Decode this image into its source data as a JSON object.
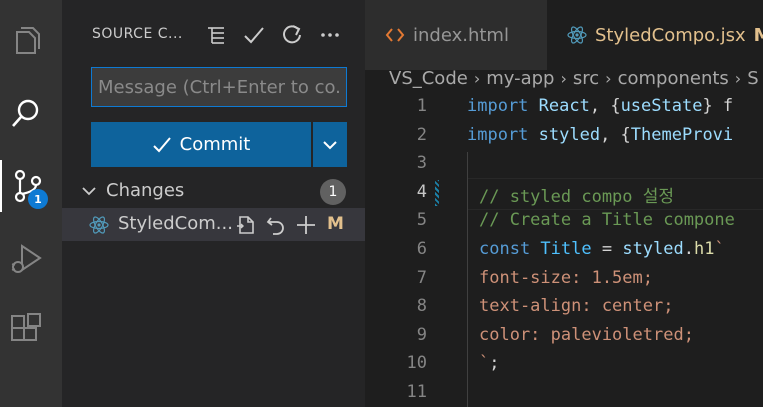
{
  "activity_bar": {
    "items": [
      {
        "name": "explorer",
        "icon": "files-icon"
      },
      {
        "name": "search",
        "icon": "search-icon"
      },
      {
        "name": "source-control",
        "icon": "source-control-icon",
        "badge": "1"
      },
      {
        "name": "run-debug",
        "icon": "run-debug-icon"
      },
      {
        "name": "extensions",
        "icon": "extensions-icon"
      }
    ]
  },
  "sidebar": {
    "title": "SOURCE C...",
    "message_placeholder": "Message (Ctrl+Enter to co...",
    "commit_label": "Commit",
    "changes": {
      "label": "Changes",
      "count": "1",
      "files": [
        {
          "name": "StyledCom...",
          "status": "M"
        }
      ]
    }
  },
  "editor": {
    "tabs": [
      {
        "label": "index.html",
        "active": false
      },
      {
        "label": "StyledCompo.jsx",
        "active": true,
        "modified": "M"
      }
    ],
    "breadcrumb": [
      "VS_Code",
      "my-app",
      "src",
      "components",
      "S"
    ],
    "lines": [
      {
        "n": "1",
        "tokens": [
          {
            "t": "import ",
            "c": "#569cd6"
          },
          {
            "t": "React",
            "c": "#9cdcfe"
          },
          {
            "t": ", {",
            "c": "#d4d4d4"
          },
          {
            "t": "useState",
            "c": "#9cdcfe"
          },
          {
            "t": "} f",
            "c": "#d4d4d4"
          }
        ]
      },
      {
        "n": "2",
        "tokens": [
          {
            "t": "import ",
            "c": "#569cd6"
          },
          {
            "t": "styled",
            "c": "#9cdcfe"
          },
          {
            "t": ", {",
            "c": "#d4d4d4"
          },
          {
            "t": "ThemeProvi",
            "c": "#9cdcfe"
          }
        ]
      },
      {
        "n": "3",
        "tokens": []
      },
      {
        "n": "4",
        "tokens": [
          {
            "t": "// styled compo 설정",
            "c": "#6a9955"
          }
        ]
      },
      {
        "n": "5",
        "tokens": [
          {
            "t": "// Create a Title compone",
            "c": "#6a9955"
          }
        ]
      },
      {
        "n": "6",
        "tokens": [
          {
            "t": "const ",
            "c": "#569cd6"
          },
          {
            "t": "Title",
            "c": "#4fc1ff"
          },
          {
            "t": " = ",
            "c": "#d4d4d4"
          },
          {
            "t": "styled",
            "c": "#9cdcfe"
          },
          {
            "t": ".",
            "c": "#d4d4d4"
          },
          {
            "t": "h1",
            "c": "#dcdcaa"
          },
          {
            "t": "`",
            "c": "#ce9178"
          }
        ]
      },
      {
        "n": "7",
        "tokens": [
          {
            "t": "font-size: 1.5em;",
            "c": "#ce9178"
          }
        ]
      },
      {
        "n": "8",
        "tokens": [
          {
            "t": "text-align: center;",
            "c": "#ce9178"
          }
        ]
      },
      {
        "n": "9",
        "tokens": [
          {
            "t": "color: palevioletred;",
            "c": "#ce9178"
          }
        ]
      },
      {
        "n": "10",
        "tokens": [
          {
            "t": "`",
            "c": "#ce9178"
          },
          {
            "t": ";",
            "c": "#d4d4d4"
          }
        ]
      },
      {
        "n": "11",
        "tokens": []
      }
    ],
    "current_line": "4"
  },
  "colors": {
    "accent": "#0e639c",
    "focus_border": "#0e7ad3",
    "modified": "#e2c08d"
  }
}
